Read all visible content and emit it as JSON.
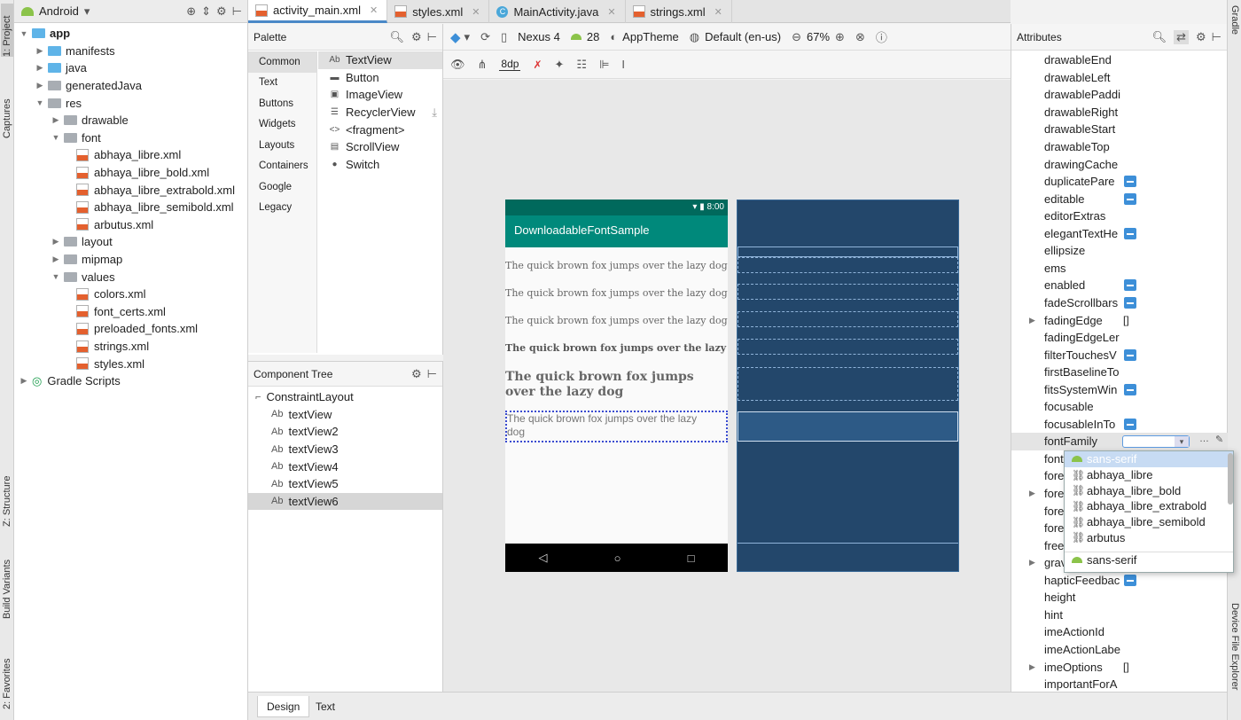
{
  "left_strip": {
    "project": "1: Project",
    "captures": "Captures",
    "structure": "Z: Structure",
    "build_variants": "Build Variants",
    "favorites": "2: Favorites"
  },
  "right_strip": {
    "gradle": "Gradle",
    "device_file_explorer": "Device File Explorer"
  },
  "project_panel": {
    "view_mode": "Android",
    "tree": [
      {
        "label": "app",
        "indent": 0,
        "arrow": "▼",
        "icon": "folder-blue",
        "bold": true
      },
      {
        "label": "manifests",
        "indent": 1,
        "arrow": "▶",
        "icon": "folder-blue"
      },
      {
        "label": "java",
        "indent": 1,
        "arrow": "▶",
        "icon": "folder-blue"
      },
      {
        "label": "generatedJava",
        "indent": 1,
        "arrow": "▶",
        "icon": "folder-grey"
      },
      {
        "label": "res",
        "indent": 1,
        "arrow": "▼",
        "icon": "folder-grey"
      },
      {
        "label": "drawable",
        "indent": 2,
        "arrow": "▶",
        "icon": "folder-grey"
      },
      {
        "label": "font",
        "indent": 2,
        "arrow": "▼",
        "icon": "folder-grey"
      },
      {
        "label": "abhaya_libre.xml",
        "indent": 3,
        "arrow": "",
        "icon": "xml"
      },
      {
        "label": "abhaya_libre_bold.xml",
        "indent": 3,
        "arrow": "",
        "icon": "xml"
      },
      {
        "label": "abhaya_libre_extrabold.xml",
        "indent": 3,
        "arrow": "",
        "icon": "xml"
      },
      {
        "label": "abhaya_libre_semibold.xml",
        "indent": 3,
        "arrow": "",
        "icon": "xml"
      },
      {
        "label": "arbutus.xml",
        "indent": 3,
        "arrow": "",
        "icon": "xml"
      },
      {
        "label": "layout",
        "indent": 2,
        "arrow": "▶",
        "icon": "folder-grey"
      },
      {
        "label": "mipmap",
        "indent": 2,
        "arrow": "▶",
        "icon": "folder-grey"
      },
      {
        "label": "values",
        "indent": 2,
        "arrow": "▼",
        "icon": "folder-grey"
      },
      {
        "label": "colors.xml",
        "indent": 3,
        "arrow": "",
        "icon": "xml"
      },
      {
        "label": "font_certs.xml",
        "indent": 3,
        "arrow": "",
        "icon": "xml"
      },
      {
        "label": "preloaded_fonts.xml",
        "indent": 3,
        "arrow": "",
        "icon": "xml"
      },
      {
        "label": "strings.xml",
        "indent": 3,
        "arrow": "",
        "icon": "xml"
      },
      {
        "label": "styles.xml",
        "indent": 3,
        "arrow": "",
        "icon": "xml"
      },
      {
        "label": "Gradle Scripts",
        "indent": 0,
        "arrow": "▶",
        "icon": "gradle"
      }
    ]
  },
  "editor_tabs": [
    {
      "label": "activity_main.xml",
      "icon": "xml",
      "active": true
    },
    {
      "label": "styles.xml",
      "icon": "xml",
      "active": false
    },
    {
      "label": "MainActivity.java",
      "icon": "class",
      "active": false
    },
    {
      "label": "strings.xml",
      "icon": "xml",
      "active": false
    }
  ],
  "palette": {
    "title": "Palette",
    "categories": [
      "Common",
      "Text",
      "Buttons",
      "Widgets",
      "Layouts",
      "Containers",
      "Google",
      "Legacy"
    ],
    "selected_category": "Common",
    "items": [
      {
        "label": "TextView",
        "icon": "Ab"
      },
      {
        "label": "Button",
        "icon": "▬"
      },
      {
        "label": "ImageView",
        "icon": "▣"
      },
      {
        "label": "RecyclerView",
        "icon": "☰"
      },
      {
        "label": "<fragment>",
        "icon": "<>"
      },
      {
        "label": "ScrollView",
        "icon": "▤"
      },
      {
        "label": "Switch",
        "icon": "●"
      }
    ]
  },
  "component_tree": {
    "title": "Component Tree",
    "root": "ConstraintLayout",
    "children": [
      "textView",
      "textView2",
      "textView3",
      "textView4",
      "textView5",
      "textView6"
    ],
    "selected": "textView6"
  },
  "toolbar": {
    "device": "Nexus 4",
    "api": "28",
    "theme": "AppTheme",
    "locale": "Default (en-us)",
    "zoom": "67%",
    "margin": "8dp"
  },
  "phone": {
    "time": "8:00",
    "app_title": "DownloadableFontSample",
    "samples": [
      "The quick brown fox jumps over the lazy dog",
      "The quick brown fox jumps over the lazy dog",
      "The quick brown fox jumps over the lazy dog",
      "The quick brown fox jumps over the lazy dog"
    ],
    "big_sample_line1": "The quick brown fox jumps",
    "big_sample_line2": "over the lazy dog",
    "selected_sample_line1": "The quick brown fox jumps over the lazy",
    "selected_sample_line2": "dog"
  },
  "attributes": {
    "title": "Attributes",
    "rows": [
      {
        "name": "drawableEnd"
      },
      {
        "name": "drawableLeft"
      },
      {
        "name": "drawablePaddi"
      },
      {
        "name": "drawableRight"
      },
      {
        "name": "drawableStart"
      },
      {
        "name": "drawableTop"
      },
      {
        "name": "drawingCache"
      },
      {
        "name": "duplicatePare",
        "toggle": true
      },
      {
        "name": "editable",
        "toggle": true
      },
      {
        "name": "editorExtras"
      },
      {
        "name": "elegantTextHe",
        "toggle": true
      },
      {
        "name": "ellipsize"
      },
      {
        "name": "ems"
      },
      {
        "name": "enabled",
        "toggle": true
      },
      {
        "name": "fadeScrollbars",
        "toggle": true
      },
      {
        "name": "fadingEdge",
        "value": "[]",
        "expandable": true
      },
      {
        "name": "fadingEdgeLer"
      },
      {
        "name": "filterTouchesV",
        "toggle": true
      },
      {
        "name": "firstBaselineTo"
      },
      {
        "name": "fitsSystemWin",
        "toggle": true
      },
      {
        "name": "focusable"
      },
      {
        "name": "focusableInTo",
        "toggle": true
      },
      {
        "name": "fontFamily",
        "highlight": true
      },
      {
        "name": "font"
      },
      {
        "name": "fore"
      },
      {
        "name": "fore",
        "expandable": true
      },
      {
        "name": "fore"
      },
      {
        "name": "fore"
      },
      {
        "name": "free"
      },
      {
        "name": "grav",
        "expandable": true
      },
      {
        "name": "hapticFeedbac",
        "toggle": true
      },
      {
        "name": "height"
      },
      {
        "name": "hint"
      },
      {
        "name": "imeActionId"
      },
      {
        "name": "imeActionLabe"
      },
      {
        "name": "imeOptions",
        "value": "[]",
        "expandable": true
      },
      {
        "name": "importantForA"
      }
    ]
  },
  "font_dropdown": {
    "options": [
      {
        "label": "sans-serif",
        "icon": "android",
        "selected": true
      },
      {
        "label": "abhaya_libre",
        "icon": "link"
      },
      {
        "label": "abhaya_libre_bold",
        "icon": "link"
      },
      {
        "label": "abhaya_libre_extrabold",
        "icon": "link"
      },
      {
        "label": "abhaya_libre_semibold",
        "icon": "link"
      },
      {
        "label": "arbutus",
        "icon": "link"
      }
    ],
    "system_option": "sans-serif"
  },
  "bottom_tabs": {
    "design": "Design",
    "text": "Text"
  },
  "colors": {
    "accent": "#4a88c7",
    "appbar": "#00897b",
    "statusbar": "#00695c",
    "blueprint": "#23476b"
  }
}
